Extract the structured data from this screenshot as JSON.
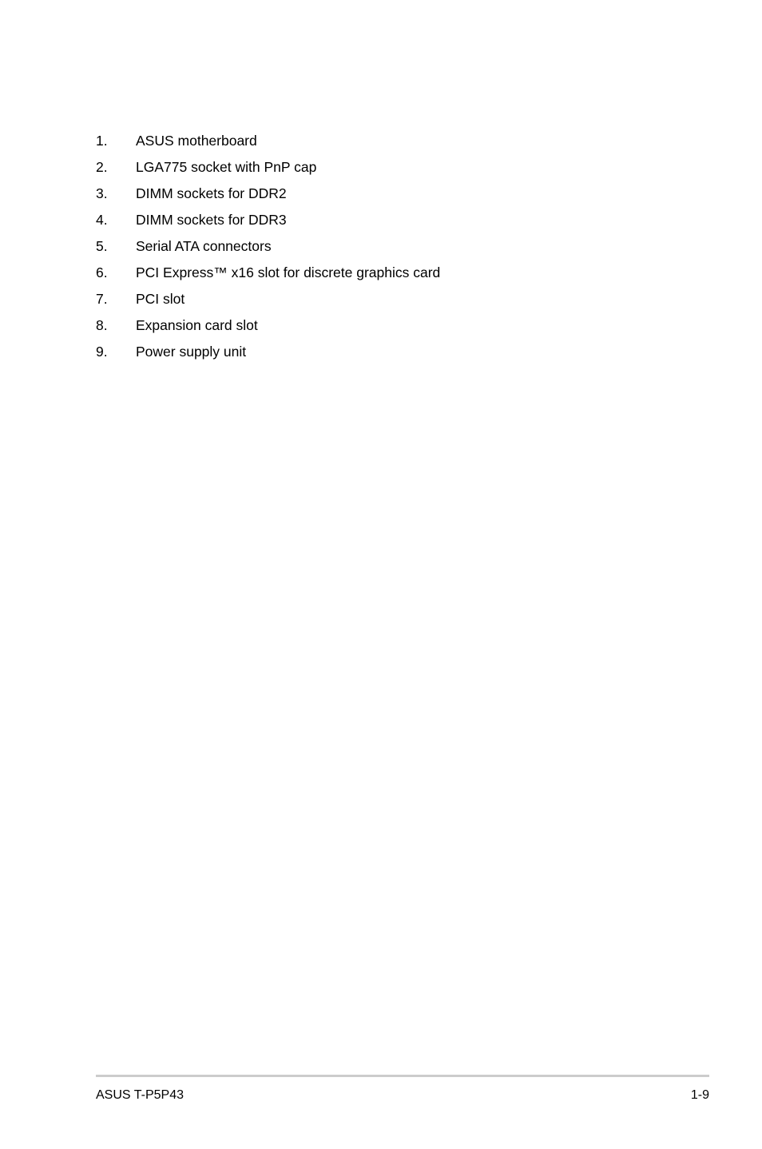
{
  "document": {
    "background_color": "#ffffff",
    "text_color": "#000000"
  },
  "main": {
    "list": [
      {
        "number": "1.",
        "label": "ASUS motherboard"
      },
      {
        "number": "2.",
        "label": "LGA775 socket with PnP cap"
      },
      {
        "number": "3.",
        "label": "DIMM sockets for DDR2"
      },
      {
        "number": "4.",
        "label": "DIMM sockets for DDR3"
      },
      {
        "number": "5.",
        "label": "Serial ATA connectors"
      },
      {
        "number": "6.",
        "label": "PCI Express™ x16 slot for discrete graphics card"
      },
      {
        "number": "7.",
        "label": "PCI slot"
      },
      {
        "number": "8.",
        "label": "Expansion card slot"
      },
      {
        "number": "9.",
        "label": "Power supply unit"
      }
    ]
  },
  "footer": {
    "product_name": "ASUS T-P5P43",
    "page_number": "1-9",
    "rule_color": "#cccccc"
  }
}
